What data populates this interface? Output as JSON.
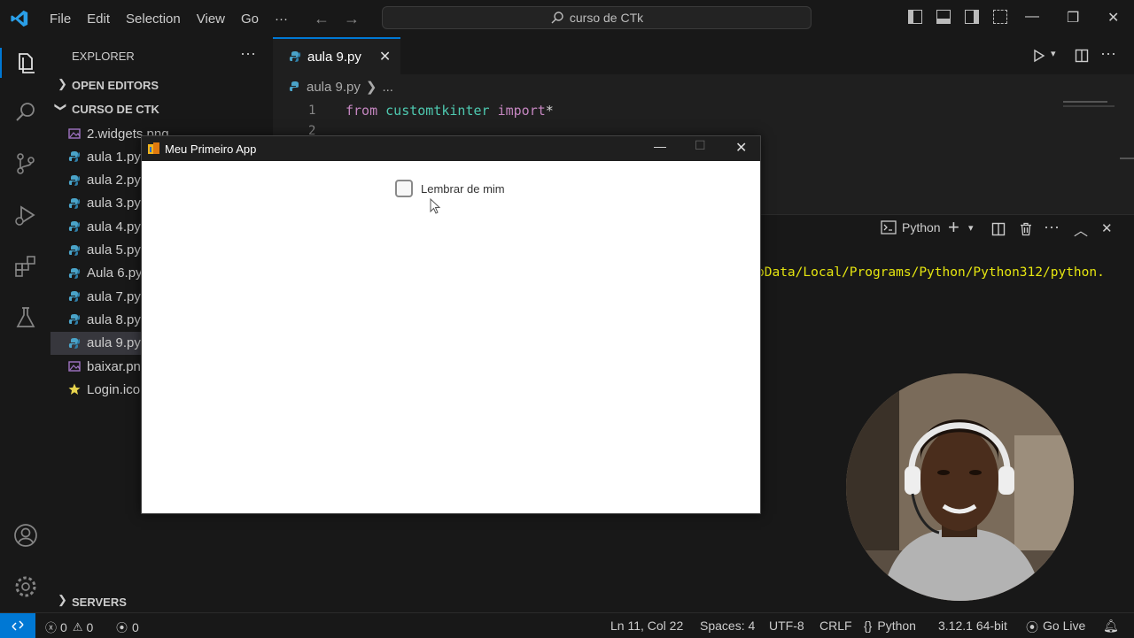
{
  "titlebar": {
    "menus": [
      "File",
      "Edit",
      "Selection",
      "View",
      "Go",
      "···"
    ],
    "search": "curso de CTk"
  },
  "sidebar": {
    "title": "EXPLORER",
    "open_editors": "OPEN EDITORS",
    "folder": "CURSO DE CTK",
    "files": [
      "2.widgets.png",
      "aula 1.py",
      "aula 2.py",
      "aula 3.py",
      "aula 4.py",
      "aula 5.py",
      "Aula 6.py",
      "aula 7.py",
      "aula 8.py",
      "aula 9.py",
      "baixar.pn",
      "Login.ico"
    ],
    "file_types": [
      "image",
      "py",
      "py",
      "py",
      "py",
      "py",
      "py",
      "py",
      "py",
      "py",
      "image",
      "star"
    ],
    "selected_file": "aula 9.py",
    "servers": "SERVERS"
  },
  "editor": {
    "tab_label": "aula 9.py",
    "breadcrumb_file": "aula 9.py",
    "breadcrumb_more": "...",
    "line_numbers": [
      "1",
      "2"
    ],
    "code_from": "from",
    "code_module": "customtkinter",
    "code_import": "import",
    "code_star": "*"
  },
  "panel": {
    "terminal_name": "Python",
    "terminal_line": "pData/Local/Programs/Python/Python312/python."
  },
  "app": {
    "title": "Meu Primeiro App",
    "checkbox_label": "Lembrar de mim",
    "checkbox_checked": false
  },
  "statusbar": {
    "errors": "0",
    "warnings": "0",
    "ports": "0",
    "position": "Ln 11, Col 22",
    "spaces": "Spaces: 4",
    "encoding": "UTF-8",
    "eol": "CRLF",
    "language": "Python",
    "interpreter": "3.12.1 64-bit",
    "golive": "Go Live"
  },
  "colors": {
    "accent": "#0078d4",
    "keyword": "#c586c0",
    "module": "#4ec9b0",
    "terminal_text": "#e5e510"
  }
}
